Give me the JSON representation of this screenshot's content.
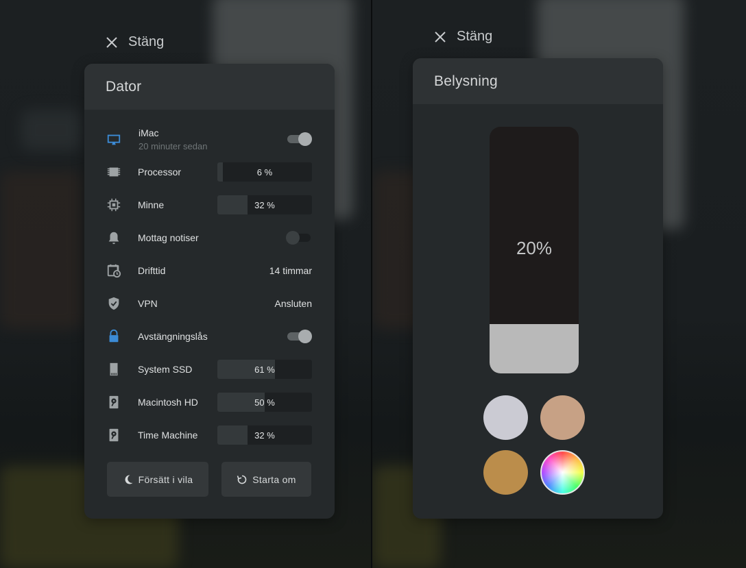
{
  "left": {
    "close_label": "Stäng",
    "title": "Dator",
    "device": {
      "name": "iMac",
      "sub": "20 minuter sedan",
      "enabled": true
    },
    "rows": [
      {
        "icon": "processor-icon",
        "label": "Processor",
        "kind": "bar",
        "value": "6 %",
        "percent": 6
      },
      {
        "icon": "memory-chip-icon",
        "label": "Minne",
        "kind": "bar",
        "value": "32 %",
        "percent": 32
      },
      {
        "icon": "bell-icon",
        "label": "Mottag notiser",
        "kind": "toggle",
        "on": false
      },
      {
        "icon": "calendar-clock-icon",
        "label": "Drifttid",
        "kind": "text",
        "value": "14 timmar"
      },
      {
        "icon": "shield-check-icon",
        "label": "VPN",
        "kind": "text",
        "value": "Ansluten"
      },
      {
        "icon": "lock-icon",
        "label": "Avstängningslås",
        "kind": "toggle",
        "on": true
      },
      {
        "icon": "sd-card-icon",
        "label": "System SSD",
        "kind": "bar",
        "value": "61 %",
        "percent": 61
      },
      {
        "icon": "harddisk-icon",
        "label": "Macintosh HD",
        "kind": "bar",
        "value": "50 %",
        "percent": 50
      },
      {
        "icon": "harddisk-icon",
        "label": "Time Machine",
        "kind": "bar",
        "value": "32 %",
        "percent": 32
      }
    ],
    "buttons": {
      "sleep": "Försätt i vila",
      "restart": "Starta om"
    }
  },
  "right": {
    "close_label": "Stäng",
    "title": "Belysning",
    "brightness_label": "20%",
    "brightness": 20,
    "swatches": [
      {
        "name": "white-swatch",
        "color": "#cbcbd3"
      },
      {
        "name": "peach-swatch",
        "color": "#c7a185"
      },
      {
        "name": "amber-swatch",
        "color": "#bb8d4b"
      },
      {
        "name": "color-wheel-swatch",
        "color": "wheel"
      }
    ]
  },
  "colors": {
    "accent": "#3c8bd6",
    "panel": "#25292b",
    "header": "#2e3234"
  }
}
